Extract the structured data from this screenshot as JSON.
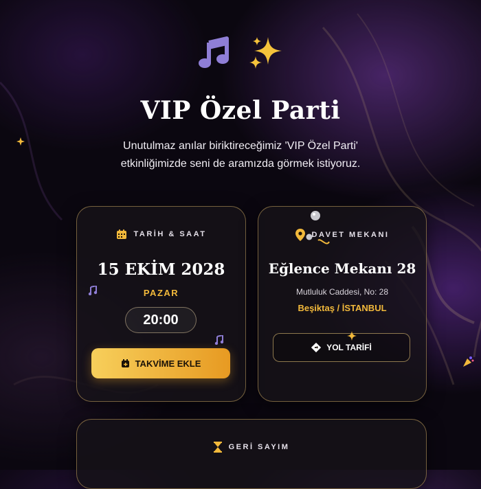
{
  "hero": {
    "icons": [
      "music-note-icon",
      "sparkles-icon"
    ]
  },
  "title": "VIP Özel Parti",
  "intro": "Unutulmaz anılar biriktireceğimiz 'VIP Özel Parti' etkinliğimizde seni de aramızda görmek istiyoruz.",
  "date_card": {
    "heading": "TARİH & SAAT",
    "date": "15 EKİM 2028",
    "weekday": "PAZAR",
    "time": "20:00",
    "calendar_button": "TAKVİME EKLE"
  },
  "venue_card": {
    "heading": "DAVET MEKANI",
    "name": "Eğlence Mekanı 28",
    "address": "Mutluluk Caddesi, No: 28",
    "city": "Beşiktaş / İSTANBUL",
    "directions_button": "YOL TARİFİ"
  },
  "countdown_card": {
    "heading": "GERİ SAYIM"
  },
  "colors": {
    "accent": "#f2b93b",
    "button_gradient": [
      "#f7cf5b",
      "#e79a22"
    ],
    "card_border": "#c8a55f",
    "background": "#0b0710"
  }
}
